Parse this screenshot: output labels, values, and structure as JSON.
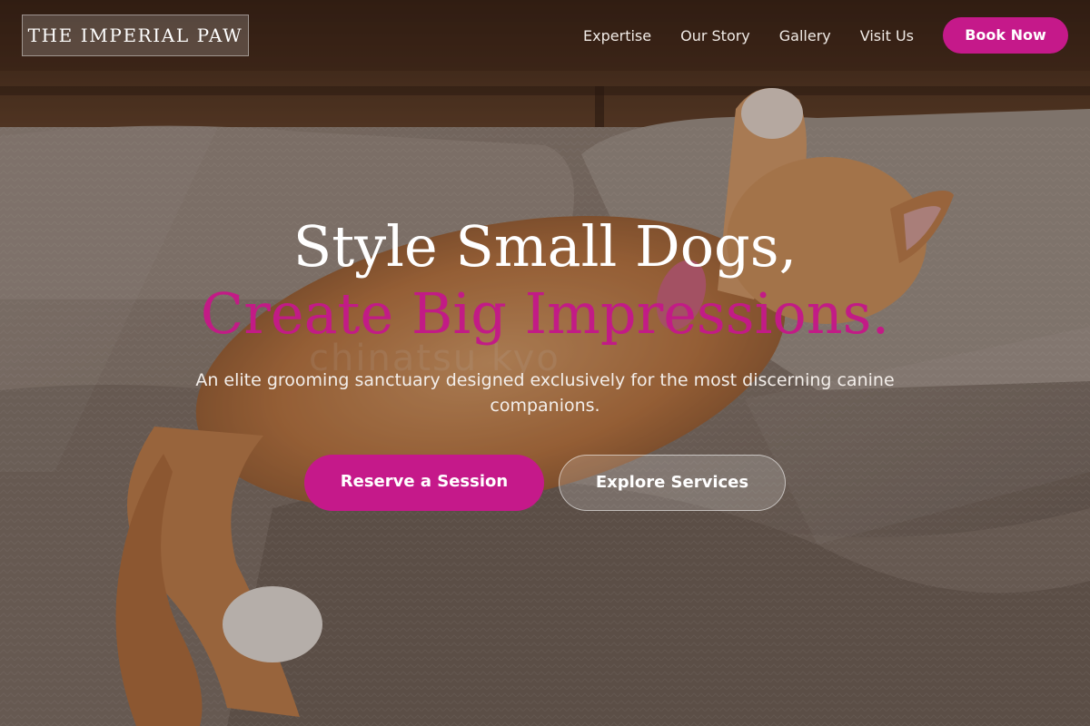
{
  "header": {
    "brand": "THE IMPERIAL PAW",
    "nav_links": [
      {
        "label": "Expertise"
      },
      {
        "label": "Our Story"
      },
      {
        "label": "Gallery"
      },
      {
        "label": "Visit Us"
      }
    ],
    "book_button": "Book Now"
  },
  "hero": {
    "title_line1": "Style Small Dogs,",
    "title_line2": "Create Big Impressions.",
    "subtitle": "An elite grooming sanctuary designed exclusively for the most discerning canine companions.",
    "primary_button": "Reserve a Session",
    "secondary_button": "Explore Services",
    "background_watermark": "chinatsu kyo"
  },
  "colors": {
    "accent": "#c5198a",
    "title_accent": "#c21b86",
    "text_light": "#ffffff"
  }
}
